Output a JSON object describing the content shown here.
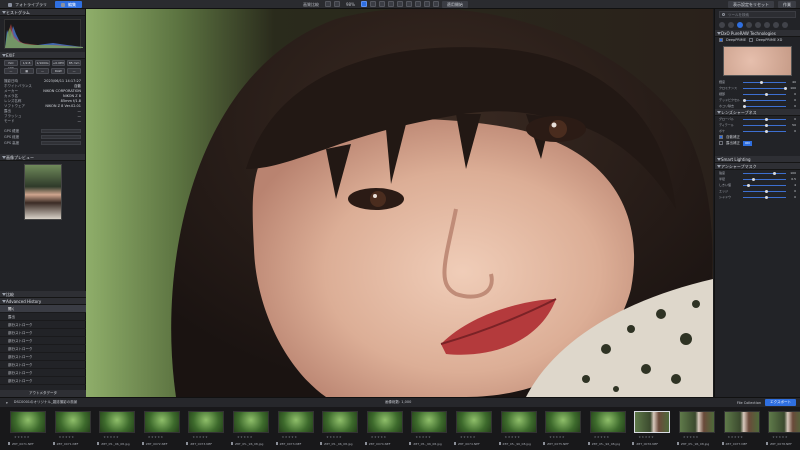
{
  "toolbar": {
    "tabs": [
      {
        "label": "フォトライブラリ",
        "active": false
      },
      {
        "label": "編集",
        "active": true
      }
    ],
    "view_label": "画質比較",
    "zoom": "98%",
    "apply_label": "適用開始",
    "right_buttons": [
      "表示設定をリセット",
      "作業"
    ]
  },
  "left_panel": {
    "histogram_title": "ヒストグラム",
    "exif_title": "EXIF",
    "exif_rows": [
      {
        "k": "撮影日時",
        "v": "2023/06/11 14:17:27"
      },
      {
        "k": "ホワイトバランス",
        "v": "自動"
      },
      {
        "k": "メーカー",
        "v": "NIKON CORPORATION"
      },
      {
        "k": "カメラ名",
        "v": "NIKON Z 8"
      },
      {
        "k": "レンズ名称",
        "v": "85mm f/1.8"
      },
      {
        "k": "ソフトウェア",
        "v": "NIKON Z 8 Ver.02.01"
      },
      {
        "k": "露出",
        "v": "—"
      },
      {
        "k": "フラッシュ",
        "v": "—"
      },
      {
        "k": "モード",
        "v": "—"
      }
    ],
    "buttons_row1": [
      "ISO 100",
      "1/2.8",
      "1/1000s",
      "+0.0EV",
      "85 mm"
    ],
    "buttons_row2": [
      "—",
      "▦",
      "—",
      "RAW",
      "—"
    ],
    "gps_rows": [
      {
        "k": "GPS 緯度",
        "v": ""
      },
      {
        "k": "GPS 経度",
        "v": ""
      },
      {
        "k": "GPS 高度",
        "v": ""
      }
    ],
    "preview_title": "画像プレビュー",
    "compare_title": "比較",
    "history_title": "Advanced History",
    "history_items": [
      "開く",
      "露出",
      "部分ストローク",
      "部分ストローク",
      "部分ストローク",
      "部分ストローク",
      "部分ストローク",
      "部分ストローク",
      "部分ストローク",
      "部分ストローク",
      "部分ストローク"
    ],
    "bottom_label": "アウトメタデータ"
  },
  "right_panel": {
    "search_placeholder": "ツールを検索",
    "module_title": "DxO PureRAW Technologies",
    "module_options": [
      "DeepPRIME",
      "DeepPRIME XD"
    ],
    "sliders_a": [
      {
        "label": "輝度",
        "value": "40"
      },
      {
        "label": "クロミナンス",
        "value": "100"
      },
      {
        "label": "細部",
        "value": "0"
      },
      {
        "label": "デッドピクセル",
        "value": "0"
      },
      {
        "label": "ホコリ除去",
        "value": "0"
      }
    ],
    "section2_title": "レンズシャープネス",
    "sliders_b": [
      {
        "label": "グローバル",
        "value": "0"
      },
      {
        "label": "ディテール",
        "value": "50"
      },
      {
        "label": "ボケ",
        "value": "0"
      }
    ],
    "toggle1": "自動補正",
    "toggle2": "露出補正",
    "tag_label": "ON",
    "section3_title": "Smart Lighting",
    "section4_title": "アンシャープマスク",
    "sliders_c": [
      {
        "label": "強度",
        "value": "100"
      },
      {
        "label": "半径",
        "value": "0.5"
      },
      {
        "label": "しきい値",
        "value": "4"
      },
      {
        "label": "エッジ",
        "value": "0"
      },
      {
        "label": "シャドウ",
        "value": "0"
      }
    ]
  },
  "filmstrip": {
    "folder": "DSC0001のオリジナル_雑誌撮影の風景",
    "count_label": "画像総数: 1,000",
    "collection": "File Collection",
    "export_label": "エクスポート",
    "frames": [
      {
        "name": "Z8T_0071.NEF",
        "type": "green"
      },
      {
        "name": "Z8T_0071.NEF",
        "type": "green"
      },
      {
        "name": "Z8T_05-_96_08.jpg",
        "type": "green"
      },
      {
        "name": "Z8T_0072.NEF",
        "type": "green"
      },
      {
        "name": "Z8T_0073.NEF",
        "type": "green"
      },
      {
        "name": "Z8T_05-_96_08.jpg",
        "type": "green"
      },
      {
        "name": "Z8T_0073.NEF",
        "type": "green"
      },
      {
        "name": "Z8T_05-_96_08.jpg",
        "type": "green"
      },
      {
        "name": "Z8T_0074.NEF",
        "type": "green"
      },
      {
        "name": "Z8T_05-_96_08.jpg",
        "type": "green"
      },
      {
        "name": "Z8T_0074.NEF",
        "type": "green"
      },
      {
        "name": "Z8T_05-_96_08.jpg",
        "type": "green"
      },
      {
        "name": "Z8T_0075.NEF",
        "type": "green"
      },
      {
        "name": "Z8T_05-_96_08.jpg",
        "type": "green"
      },
      {
        "name": "Z8T_0076.NEF",
        "type": "person"
      },
      {
        "name": "Z8T_05-_96_08.jpg",
        "type": "person"
      },
      {
        "name": "Z8T_0077.NEF",
        "type": "person"
      },
      {
        "name": "Z8T_0078.NEF",
        "type": "person"
      }
    ]
  }
}
